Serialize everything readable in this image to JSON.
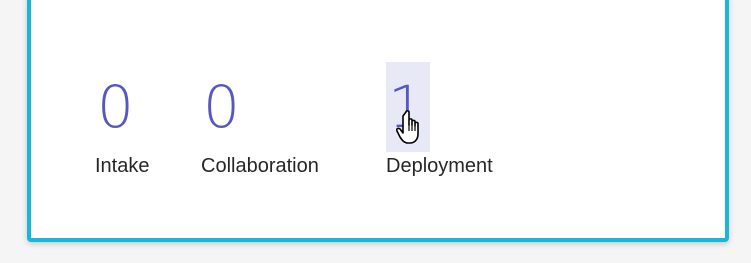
{
  "stats": [
    {
      "count": "0",
      "label": "Intake"
    },
    {
      "count": "0",
      "label": "Collaboration"
    },
    {
      "count": "1",
      "label": "Deployment"
    }
  ],
  "colors": {
    "accent_border": "#1ab6d8",
    "count": "#5558c4",
    "hover_background": "#e8e9f6"
  },
  "cursor": "hand-pointer-icon"
}
